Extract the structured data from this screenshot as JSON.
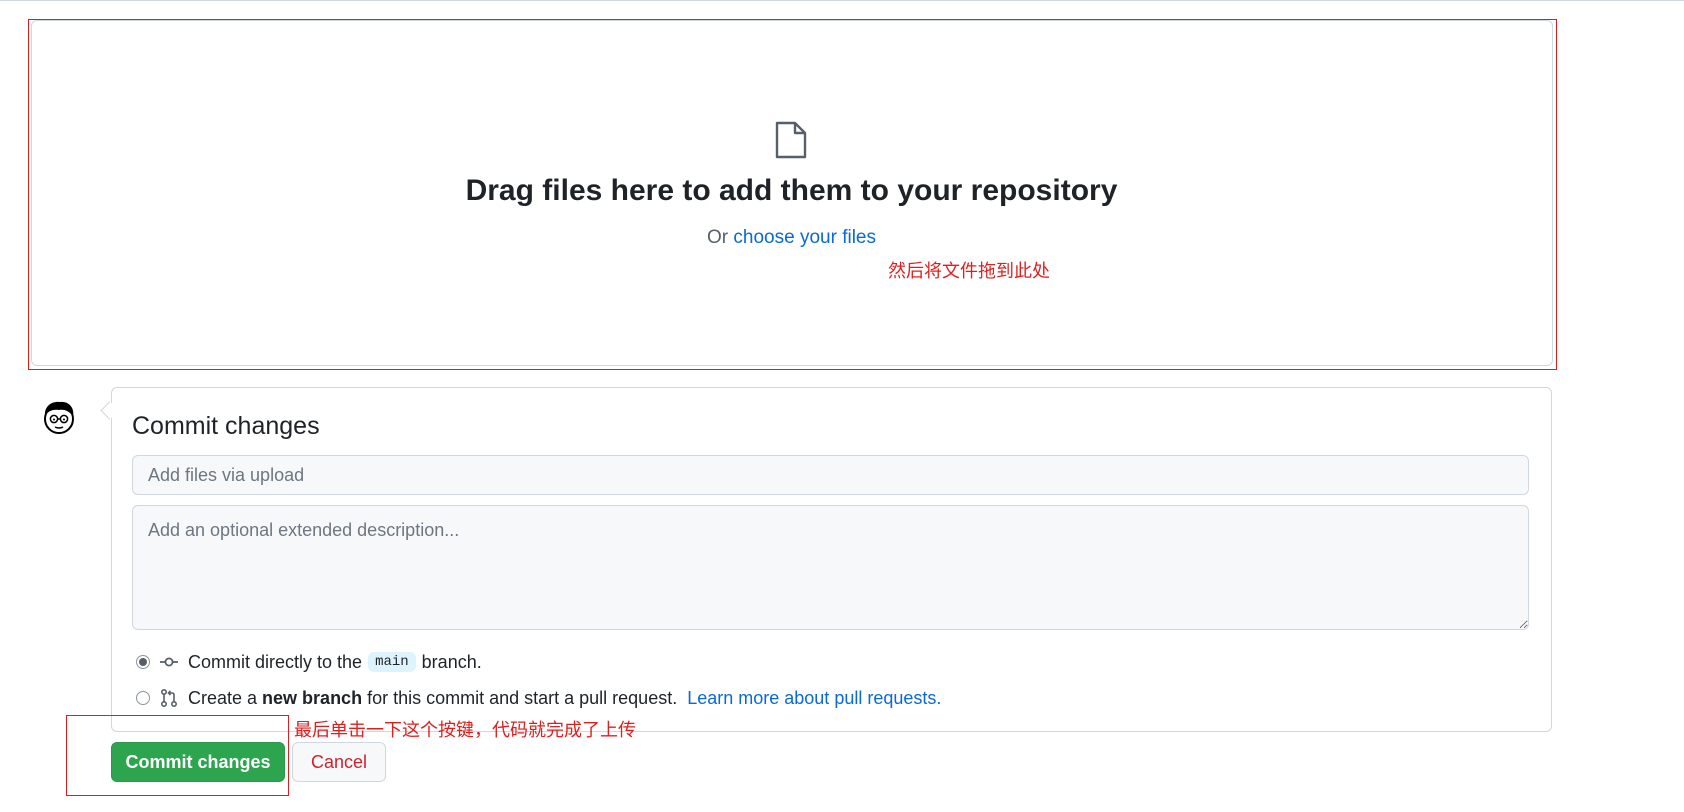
{
  "upload": {
    "title": "Drag files here to add them to your repository",
    "or_text": "Or",
    "choose_link": "choose your files"
  },
  "annotations": {
    "drop_hint": "然后将文件拖到此处",
    "button_hint": "最后单击一下这个按键，代码就完成了上传",
    "color": "#e01e1e"
  },
  "commit": {
    "title": "Commit changes",
    "summary_placeholder": "Add files via upload",
    "description_placeholder": "Add an optional extended description...",
    "option_direct": {
      "prefix": "Commit directly to the",
      "branch": "main",
      "suffix": "branch.",
      "icon": "git-commit-icon",
      "selected": true
    },
    "option_new_branch": {
      "prefix": "Create a",
      "bold": "new branch",
      "middle": "for this commit and start a pull request.",
      "link": "Learn more about pull requests.",
      "icon": "git-pull-request-icon",
      "selected": false
    }
  },
  "buttons": {
    "commit_label": "Commit changes",
    "cancel_label": "Cancel"
  },
  "colors": {
    "primary_button": "#2da44e",
    "link": "#0969da",
    "cancel_text": "#cf222e"
  }
}
